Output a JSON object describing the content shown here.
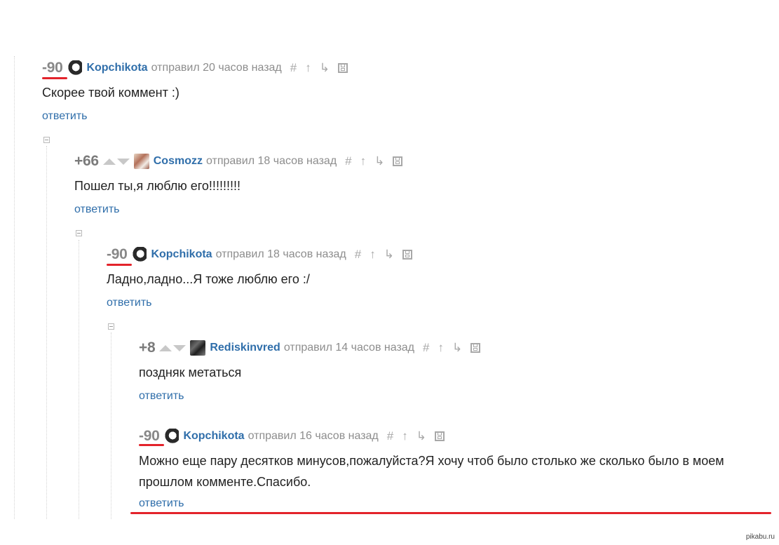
{
  "comments": [
    {
      "rating": "-90",
      "author": "Kopchikota",
      "meta": "отправил 20 часов назад",
      "text": "Скорее твой коммент :)",
      "reply": "ответить",
      "avatar": "kopchikota-avatar"
    },
    {
      "rating": "+66",
      "author": "Cosmozz",
      "meta": "отправил 18 часов назад",
      "text": "Пошел ты,я люблю его!!!!!!!!!",
      "reply": "ответить",
      "avatar": "cosmozz-avatar"
    },
    {
      "rating": "-90",
      "author": "Kopchikota",
      "meta": "отправил 18 часов назад",
      "text": "Ладно,ладно...Я тоже люблю его :/",
      "reply": "ответить",
      "avatar": "kopchikota-avatar"
    },
    {
      "rating": "+8",
      "author": "Rediskinvred",
      "meta": "отправил 14 часов назад",
      "text": "поздняк метаться",
      "reply": "ответить",
      "avatar": "rediskinvred-avatar"
    },
    {
      "rating": "-90",
      "author": "Kopchikota",
      "meta": "отправил 16 часов назад",
      "text_line1": "Можно еще пару десятков минусов,пожалуйста?Я хочу чтоб было столько же сколько было в моем",
      "text_line2": "прошлом комменте.Спасибо.",
      "reply": "ответить",
      "avatar": "kopchikota-avatar"
    }
  ],
  "tools": {
    "hash": "#",
    "up": "↑",
    "branch": "↳"
  },
  "watermark": "pikabu.ru",
  "colors": {
    "link": "#2f6eaa",
    "highlight": "#e3232b",
    "muted": "#8d8d8d"
  }
}
